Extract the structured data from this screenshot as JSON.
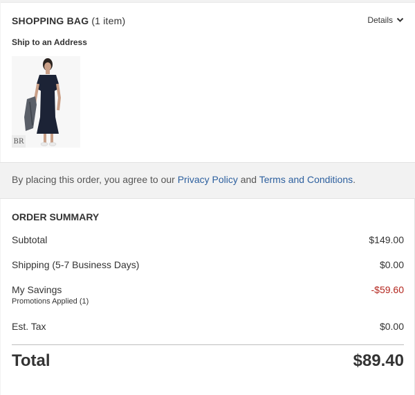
{
  "bag": {
    "title": "SHOPPING BAG",
    "item_count": "(1 item)",
    "details_label": "Details",
    "ship_to": "Ship to an Address",
    "product_badge": "BR"
  },
  "terms": {
    "prefix": "By placing this order, you agree to our",
    "privacy_link": "Privacy Policy",
    "conjunction": "and",
    "terms_link": "Terms and Conditions",
    "suffix": "."
  },
  "summary": {
    "title": "ORDER SUMMARY",
    "subtotal_label": "Subtotal",
    "subtotal_value": "$149.00",
    "shipping_label": "Shipping (5-7 Business Days)",
    "shipping_value": "$0.00",
    "savings_label": "My Savings",
    "savings_sub": "Promotions Applied (1)",
    "savings_value": "-$59.60",
    "tax_label": "Est. Tax",
    "tax_value": "$0.00",
    "total_label": "Total",
    "total_value": "$89.40"
  },
  "colors": {
    "link": "#2c5f9e",
    "savings": "#b3261e",
    "background": "#f2f2f2",
    "card": "#ffffff"
  }
}
